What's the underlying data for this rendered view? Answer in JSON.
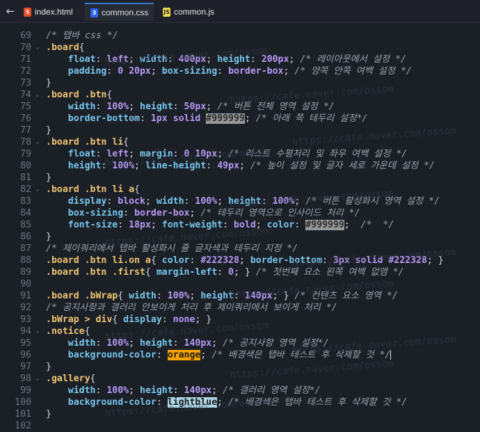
{
  "back_icon": "back-arrow-icon",
  "tabs": [
    {
      "label": "index.html",
      "icon": "html5-file-icon",
      "active": false
    },
    {
      "label": "common.css",
      "icon": "css3-file-icon",
      "active": true
    },
    {
      "label": "common.js",
      "icon": "js-file-icon",
      "active": false
    }
  ],
  "watermark": "https://cafe.naver.com/ossom",
  "colors": {
    "bg": "#1b1f26",
    "selector": "#f0c674",
    "property": "#78c8ee",
    "value": "#b79af5",
    "comment": "#9aa3ad",
    "swatch_grey": "#999999",
    "swatch_orange": "#ffa500",
    "swatch_lightblue": "#add8e6"
  },
  "lines": [
    {
      "n": "69",
      "fold": "",
      "tokens": [
        {
          "t": "com",
          "v": "/* 탭바 css */"
        }
      ]
    },
    {
      "n": "70",
      "fold": "v",
      "tokens": [
        {
          "t": "sel",
          "v": ".board"
        },
        {
          "t": "punc",
          "v": "{"
        }
      ]
    },
    {
      "n": "71",
      "fold": "",
      "tokens": [
        {
          "t": "punc",
          "v": "    "
        },
        {
          "t": "prop",
          "v": "float"
        },
        {
          "t": "punc",
          "v": ": "
        },
        {
          "t": "val",
          "v": "left"
        },
        {
          "t": "punc",
          "v": "; "
        },
        {
          "t": "prop",
          "v": "width"
        },
        {
          "t": "punc",
          "v": ": "
        },
        {
          "t": "val",
          "v": "400px"
        },
        {
          "t": "punc",
          "v": "; "
        },
        {
          "t": "prop",
          "v": "height"
        },
        {
          "t": "punc",
          "v": ": "
        },
        {
          "t": "val",
          "v": "200px"
        },
        {
          "t": "punc",
          "v": "; "
        },
        {
          "t": "com",
          "v": "/* 레이아웃에서 설정 */"
        }
      ]
    },
    {
      "n": "72",
      "fold": "",
      "tokens": [
        {
          "t": "punc",
          "v": "    "
        },
        {
          "t": "prop",
          "v": "padding"
        },
        {
          "t": "punc",
          "v": ": "
        },
        {
          "t": "val",
          "v": "0 20px"
        },
        {
          "t": "punc",
          "v": "; "
        },
        {
          "t": "prop",
          "v": "box-sizing"
        },
        {
          "t": "punc",
          "v": ": "
        },
        {
          "t": "val",
          "v": "border-box"
        },
        {
          "t": "punc",
          "v": "; "
        },
        {
          "t": "com",
          "v": "/* 양쪽 안쪽 여백 설정 */"
        }
      ]
    },
    {
      "n": "73",
      "fold": "",
      "tokens": [
        {
          "t": "punc",
          "v": "}"
        }
      ]
    },
    {
      "n": "74",
      "fold": "v",
      "tokens": [
        {
          "t": "sel",
          "v": ".board .btn"
        },
        {
          "t": "punc",
          "v": "{"
        }
      ]
    },
    {
      "n": "75",
      "fold": "",
      "tokens": [
        {
          "t": "punc",
          "v": "    "
        },
        {
          "t": "prop",
          "v": "width"
        },
        {
          "t": "punc",
          "v": ": "
        },
        {
          "t": "val",
          "v": "100%"
        },
        {
          "t": "punc",
          "v": "; "
        },
        {
          "t": "prop",
          "v": "height"
        },
        {
          "t": "punc",
          "v": ": "
        },
        {
          "t": "val",
          "v": "50px"
        },
        {
          "t": "punc",
          "v": "; "
        },
        {
          "t": "com",
          "v": "/* 버튼 전체 영역 설정 */"
        }
      ]
    },
    {
      "n": "76",
      "fold": "",
      "tokens": [
        {
          "t": "punc",
          "v": "    "
        },
        {
          "t": "prop",
          "v": "border-bottom"
        },
        {
          "t": "punc",
          "v": ": "
        },
        {
          "t": "val",
          "v": "1px solid "
        },
        {
          "t": "sw-grey",
          "v": "#999999"
        },
        {
          "t": "punc",
          "v": "; "
        },
        {
          "t": "com",
          "v": "/* 아래 쪽 테두리 설정*/"
        }
      ]
    },
    {
      "n": "77",
      "fold": "",
      "tokens": [
        {
          "t": "punc",
          "v": "}"
        }
      ]
    },
    {
      "n": "78",
      "fold": "v",
      "tokens": [
        {
          "t": "sel",
          "v": ".board .btn li"
        },
        {
          "t": "punc",
          "v": "{"
        }
      ]
    },
    {
      "n": "79",
      "fold": "",
      "tokens": [
        {
          "t": "punc",
          "v": "    "
        },
        {
          "t": "prop",
          "v": "float"
        },
        {
          "t": "punc",
          "v": ": "
        },
        {
          "t": "val",
          "v": "left"
        },
        {
          "t": "punc",
          "v": "; "
        },
        {
          "t": "prop",
          "v": "margin"
        },
        {
          "t": "punc",
          "v": ": "
        },
        {
          "t": "val",
          "v": "0 10px"
        },
        {
          "t": "punc",
          "v": "; "
        },
        {
          "t": "com",
          "v": "/* 리스트 수평처리 및 좌우 여백 설정 */"
        }
      ]
    },
    {
      "n": "80",
      "fold": "",
      "tokens": [
        {
          "t": "punc",
          "v": "    "
        },
        {
          "t": "prop",
          "v": "height"
        },
        {
          "t": "punc",
          "v": ": "
        },
        {
          "t": "val",
          "v": "100%"
        },
        {
          "t": "punc",
          "v": "; "
        },
        {
          "t": "prop",
          "v": "line-height"
        },
        {
          "t": "punc",
          "v": ": "
        },
        {
          "t": "val",
          "v": "49px"
        },
        {
          "t": "punc",
          "v": "; "
        },
        {
          "t": "com",
          "v": "/* 높이 설정 및 글자 세로 가운데 설정 */"
        }
      ]
    },
    {
      "n": "81",
      "fold": "",
      "tokens": [
        {
          "t": "punc",
          "v": "}"
        }
      ]
    },
    {
      "n": "82",
      "fold": "v",
      "tokens": [
        {
          "t": "sel",
          "v": ".board .btn li a"
        },
        {
          "t": "punc",
          "v": "{"
        }
      ]
    },
    {
      "n": "83",
      "fold": "",
      "tokens": [
        {
          "t": "punc",
          "v": "    "
        },
        {
          "t": "prop",
          "v": "display"
        },
        {
          "t": "punc",
          "v": ": "
        },
        {
          "t": "val",
          "v": "block"
        },
        {
          "t": "punc",
          "v": "; "
        },
        {
          "t": "prop",
          "v": "width"
        },
        {
          "t": "punc",
          "v": ": "
        },
        {
          "t": "val",
          "v": "100%"
        },
        {
          "t": "punc",
          "v": "; "
        },
        {
          "t": "prop",
          "v": "height"
        },
        {
          "t": "punc",
          "v": ": "
        },
        {
          "t": "val",
          "v": "100%"
        },
        {
          "t": "punc",
          "v": "; "
        },
        {
          "t": "com",
          "v": "/* 버튼 활성화시 영역 설정 */"
        }
      ]
    },
    {
      "n": "84",
      "fold": "",
      "tokens": [
        {
          "t": "punc",
          "v": "    "
        },
        {
          "t": "prop",
          "v": "box-sizing"
        },
        {
          "t": "punc",
          "v": ": "
        },
        {
          "t": "val",
          "v": "border-box"
        },
        {
          "t": "punc",
          "v": "; "
        },
        {
          "t": "com",
          "v": "/* 테두리 영역으로 인사이드 처리 */"
        }
      ]
    },
    {
      "n": "85",
      "fold": "",
      "tokens": [
        {
          "t": "punc",
          "v": "    "
        },
        {
          "t": "prop",
          "v": "font-size"
        },
        {
          "t": "punc",
          "v": ": "
        },
        {
          "t": "val",
          "v": "18px"
        },
        {
          "t": "punc",
          "v": "; "
        },
        {
          "t": "prop",
          "v": "font-weight"
        },
        {
          "t": "punc",
          "v": ": "
        },
        {
          "t": "val",
          "v": "bold"
        },
        {
          "t": "punc",
          "v": "; "
        },
        {
          "t": "prop",
          "v": "color"
        },
        {
          "t": "punc",
          "v": ": "
        },
        {
          "t": "sw-grey",
          "v": "#999999"
        },
        {
          "t": "punc",
          "v": ";  "
        },
        {
          "t": "com",
          "v": "/*  */"
        }
      ]
    },
    {
      "n": "86",
      "fold": "",
      "tokens": [
        {
          "t": "punc",
          "v": "}"
        }
      ]
    },
    {
      "n": "87",
      "fold": "",
      "tokens": [
        {
          "t": "com",
          "v": "/* 제이쿼리에서 탭바 활성화시 줄 글자색과 테두리 지정 */"
        }
      ]
    },
    {
      "n": "88",
      "fold": "",
      "tokens": [
        {
          "t": "sel",
          "v": ".board .btn li.on a"
        },
        {
          "t": "punc",
          "v": "{ "
        },
        {
          "t": "prop",
          "v": "color"
        },
        {
          "t": "punc",
          "v": ": "
        },
        {
          "t": "val",
          "v": "#222328"
        },
        {
          "t": "punc",
          "v": "; "
        },
        {
          "t": "prop",
          "v": "border-bottom"
        },
        {
          "t": "punc",
          "v": ": "
        },
        {
          "t": "val",
          "v": "3px solid #222328"
        },
        {
          "t": "punc",
          "v": "; }"
        }
      ]
    },
    {
      "n": "89",
      "fold": "",
      "tokens": [
        {
          "t": "sel",
          "v": ".board .btn .first"
        },
        {
          "t": "punc",
          "v": "{ "
        },
        {
          "t": "prop",
          "v": "margin-left"
        },
        {
          "t": "punc",
          "v": ": "
        },
        {
          "t": "val",
          "v": "0"
        },
        {
          "t": "punc",
          "v": "; } "
        },
        {
          "t": "com",
          "v": "/* 첫번째 요소 왼쪽 여백 없앰 */"
        }
      ]
    },
    {
      "n": "90",
      "fold": "",
      "tokens": []
    },
    {
      "n": "91",
      "fold": "",
      "tokens": [
        {
          "t": "sel",
          "v": ".board .bWrap"
        },
        {
          "t": "punc",
          "v": "{ "
        },
        {
          "t": "prop",
          "v": "width"
        },
        {
          "t": "punc",
          "v": ": "
        },
        {
          "t": "val",
          "v": "100%"
        },
        {
          "t": "punc",
          "v": "; "
        },
        {
          "t": "prop",
          "v": "height"
        },
        {
          "t": "punc",
          "v": ": "
        },
        {
          "t": "val",
          "v": "140px"
        },
        {
          "t": "punc",
          "v": "; } "
        },
        {
          "t": "com",
          "v": "/* 컨텐츠 요소 영역 */"
        }
      ]
    },
    {
      "n": "92",
      "fold": "",
      "tokens": [
        {
          "t": "com",
          "v": "/* 공지사항과 갤러리 안보이게 처리 후 제이쿼리에서 보이게 처리 */"
        }
      ]
    },
    {
      "n": "93",
      "fold": "",
      "tokens": [
        {
          "t": "sel",
          "v": ".bWrap > div"
        },
        {
          "t": "punc",
          "v": "{ "
        },
        {
          "t": "prop",
          "v": "display"
        },
        {
          "t": "punc",
          "v": ": "
        },
        {
          "t": "val",
          "v": "none"
        },
        {
          "t": "punc",
          "v": "; }"
        }
      ]
    },
    {
      "n": "94",
      "fold": "v",
      "tokens": [
        {
          "t": "sel",
          "v": ".notice"
        },
        {
          "t": "punc",
          "v": "{"
        }
      ]
    },
    {
      "n": "95",
      "fold": "",
      "tokens": [
        {
          "t": "punc",
          "v": "    "
        },
        {
          "t": "prop",
          "v": "width"
        },
        {
          "t": "punc",
          "v": ": "
        },
        {
          "t": "val",
          "v": "100%"
        },
        {
          "t": "punc",
          "v": "; "
        },
        {
          "t": "prop",
          "v": "height"
        },
        {
          "t": "punc",
          "v": ": "
        },
        {
          "t": "val",
          "v": "140px"
        },
        {
          "t": "punc",
          "v": "; "
        },
        {
          "t": "com",
          "v": "/* 공지사항 영역 설정*/"
        }
      ]
    },
    {
      "n": "96",
      "fold": "",
      "tokens": [
        {
          "t": "punc",
          "v": "    "
        },
        {
          "t": "prop",
          "v": "background-color"
        },
        {
          "t": "punc",
          "v": ": "
        },
        {
          "t": "sw-orange",
          "v": "orange"
        },
        {
          "t": "punc",
          "v": "; "
        },
        {
          "t": "com",
          "v": "/* 배경색은 탭바 테스트 후 삭제할 것 */"
        },
        {
          "t": "cursor",
          "v": ""
        }
      ]
    },
    {
      "n": "97",
      "fold": "",
      "tokens": [
        {
          "t": "punc",
          "v": "}"
        }
      ]
    },
    {
      "n": "98",
      "fold": "v",
      "tokens": [
        {
          "t": "sel",
          "v": ".gallery"
        },
        {
          "t": "punc",
          "v": "{"
        }
      ]
    },
    {
      "n": "99",
      "fold": "",
      "tokens": [
        {
          "t": "punc",
          "v": "    "
        },
        {
          "t": "prop",
          "v": "width"
        },
        {
          "t": "punc",
          "v": ": "
        },
        {
          "t": "val",
          "v": "100%"
        },
        {
          "t": "punc",
          "v": "; "
        },
        {
          "t": "prop",
          "v": "height"
        },
        {
          "t": "punc",
          "v": ": "
        },
        {
          "t": "val",
          "v": "140px"
        },
        {
          "t": "punc",
          "v": "; "
        },
        {
          "t": "com",
          "v": "/* 갤러리 영역 설정*/"
        }
      ]
    },
    {
      "n": "100",
      "fold": "",
      "tokens": [
        {
          "t": "punc",
          "v": "    "
        },
        {
          "t": "prop",
          "v": "background-color"
        },
        {
          "t": "punc",
          "v": ": "
        },
        {
          "t": "sw-lblue",
          "v": "lightblue"
        },
        {
          "t": "punc",
          "v": "; "
        },
        {
          "t": "com",
          "v": "/* 배경색은 탭바 테스트 후 삭제할 것 */"
        }
      ]
    },
    {
      "n": "101",
      "fold": "",
      "tokens": [
        {
          "t": "punc",
          "v": "}"
        }
      ]
    },
    {
      "n": "102",
      "fold": "",
      "tokens": []
    }
  ]
}
